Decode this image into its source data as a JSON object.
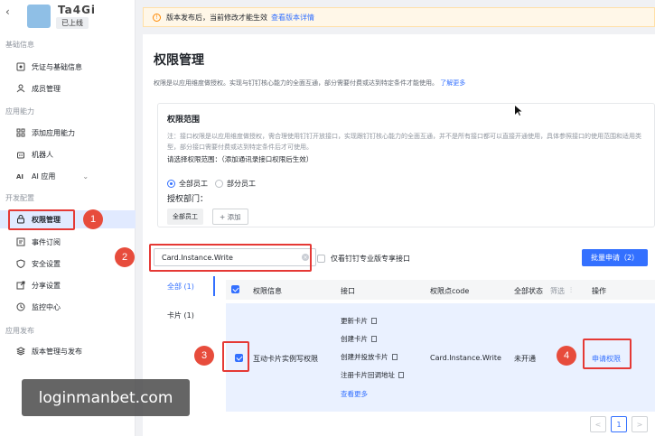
{
  "app": {
    "name": "Ta4Gi",
    "status": "已上线"
  },
  "sidebar": {
    "sections": [
      {
        "title": "基础信息",
        "items": [
          "凭证与基础信息",
          "成员管理"
        ]
      },
      {
        "title": "应用能力",
        "items": [
          "添加应用能力",
          "机器人",
          "AI 应用"
        ]
      },
      {
        "title": "开发配置",
        "items": [
          "权限管理",
          "事件订阅",
          "安全设置",
          "分享设置",
          "监控中心"
        ]
      },
      {
        "title": "应用发布",
        "items": [
          "版本管理与发布"
        ]
      }
    ],
    "active_item": "权限管理"
  },
  "notice": {
    "text": "版本发布后，当前修改才能生效",
    "link": "查看版本详情"
  },
  "page": {
    "title": "权限管理",
    "desc": "权限是以应用维度做授权。实现与钉钉核心能力的全面互通，部分需要付费或达到特定条件才能使用。",
    "desc_link": "了解更多"
  },
  "scope": {
    "title": "权限范围",
    "note": "注：接口权限是以应用维度做授权，需合理使用钉钉开放接口，实现跟钉钉核心能力的全面互通，并不是所有接口都可以直接开通使用，具体参照接口的使用范围和适用类型，部分接口需要付费或达到特定条件后才可使用。",
    "choose": "请选择权限范围：（添加通讯录接口权限后生效）",
    "radio_all": "全部员工",
    "radio_part": "部分员工",
    "dept_label": "授权部门：",
    "dept_tag": "全部员工",
    "add_label": "+ 添加"
  },
  "filters": {
    "search_value": "Card.Instance.Write",
    "pro_only_label": "仅看钉钉专业版专享接口",
    "batch_button": "批量申请（2）"
  },
  "tabs": [
    {
      "label": "全部 (1)"
    },
    {
      "label": "卡片 (1)"
    }
  ],
  "table": {
    "headers": {
      "info": "权限信息",
      "api": "接口",
      "code": "权限点code",
      "status": "全部状态",
      "filter": "筛选",
      "action": "操作"
    },
    "row": {
      "name": "互动卡片实例写权限",
      "apis": [
        "更新卡片",
        "创建卡片",
        "创建并投放卡片",
        "注册卡片回调地址"
      ],
      "more": "查看更多",
      "code": "Card.Instance.Write",
      "status": "未开通",
      "action": "申请权限"
    }
  },
  "pagination": {
    "prev": "<",
    "current": "1",
    "next": ">"
  },
  "annotations": [
    "1",
    "2",
    "3",
    "4"
  ],
  "watermark": "loginmanbet.com",
  "colors": {
    "accent": "#3370ff",
    "marker": "#e74c3c",
    "active_bg": "#e1eaff"
  }
}
